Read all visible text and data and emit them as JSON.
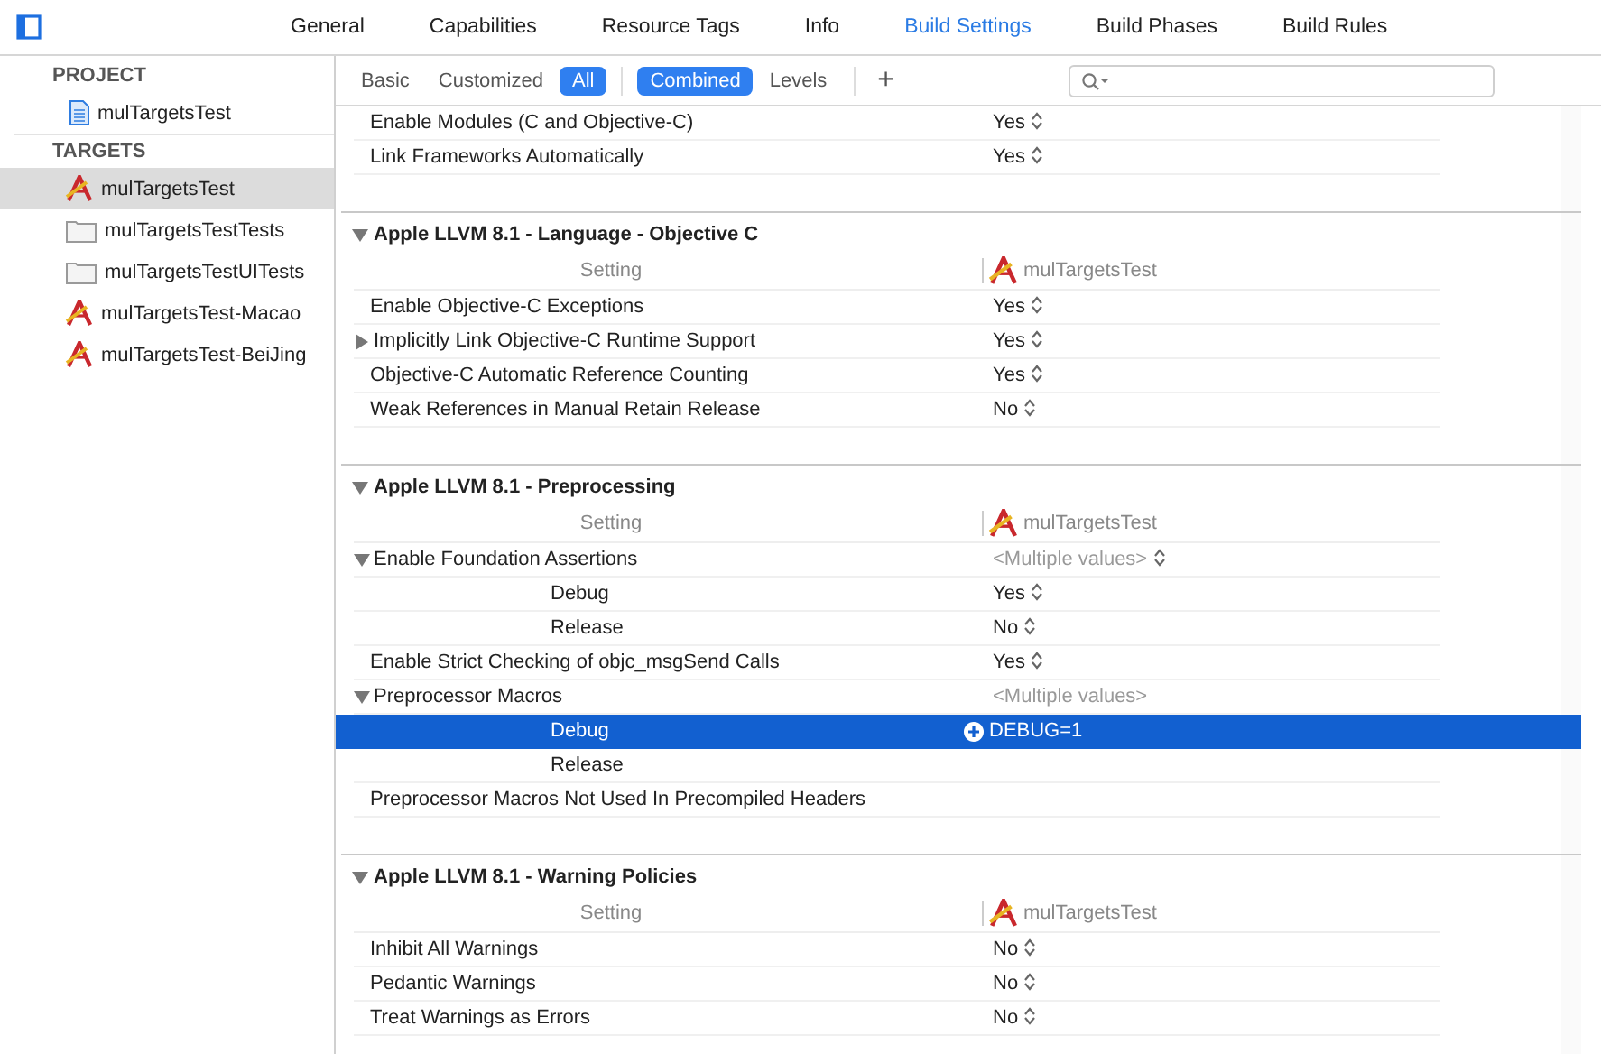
{
  "tabs": [
    {
      "label": "General",
      "selected": false
    },
    {
      "label": "Capabilities",
      "selected": false
    },
    {
      "label": "Resource Tags",
      "selected": false
    },
    {
      "label": "Info",
      "selected": false
    },
    {
      "label": "Build Settings",
      "selected": true
    },
    {
      "label": "Build Phases",
      "selected": false
    },
    {
      "label": "Build Rules",
      "selected": false
    }
  ],
  "sidebar": {
    "groups": [
      {
        "title": "PROJECT",
        "items": [
          {
            "label": "mulTargetsTest",
            "kind": "project",
            "selected": false
          }
        ]
      },
      {
        "title": "TARGETS",
        "items": [
          {
            "label": "mulTargetsTest",
            "kind": "app",
            "selected": true
          },
          {
            "label": "mulTargetsTestTests",
            "kind": "bundle",
            "selected": false
          },
          {
            "label": "mulTargetsTestUITests",
            "kind": "bundle",
            "selected": false
          },
          {
            "label": "mulTargetsTest-Macao",
            "kind": "app",
            "selected": false
          },
          {
            "label": "mulTargetsTest-BeiJing",
            "kind": "app",
            "selected": false
          }
        ]
      }
    ]
  },
  "filter_bar": {
    "scope": [
      {
        "label": "Basic",
        "selected": false
      },
      {
        "label": "Customized",
        "selected": false
      },
      {
        "label": "All",
        "selected": true
      }
    ],
    "view": [
      {
        "label": "Combined",
        "selected": true
      },
      {
        "label": "Levels",
        "selected": false
      }
    ],
    "add_label": "+"
  },
  "sections": [
    {
      "rows": [
        {
          "kind": "setting",
          "label": "Enable Modules (C and Objective-C)",
          "value": "Yes",
          "stepper": true,
          "selected": false
        },
        {
          "kind": "setting",
          "label": "Link Frameworks Automatically",
          "value": "Yes",
          "stepper": true,
          "selected": false
        }
      ]
    },
    {
      "title": "Apple LLVM 8.1 - Language - Objective C",
      "expanded": true,
      "column": "Setting",
      "target": "mulTargetsTest",
      "rows": [
        {
          "kind": "setting",
          "label": "Enable Objective-C Exceptions",
          "value": "Yes",
          "stepper": true,
          "selected": false
        },
        {
          "kind": "group",
          "expanded": false,
          "label": "Implicitly Link Objective-C Runtime Support",
          "value": "Yes",
          "stepper": true,
          "selected": false
        },
        {
          "kind": "setting",
          "label": "Objective-C Automatic Reference Counting",
          "value": "Yes",
          "stepper": true,
          "selected": false
        },
        {
          "kind": "setting",
          "label": "Weak References in Manual Retain Release",
          "value": "No",
          "stepper": true,
          "selected": false
        }
      ]
    },
    {
      "title": "Apple LLVM 8.1 - Preprocessing",
      "expanded": true,
      "column": "Setting",
      "target": "mulTargetsTest",
      "rows": [
        {
          "kind": "group",
          "expanded": true,
          "label": "Enable Foundation Assertions",
          "value": "<Multiple values>",
          "stepper": true,
          "selected": false
        },
        {
          "kind": "config",
          "label": "Debug",
          "value": "Yes",
          "stepper": true,
          "selected": false
        },
        {
          "kind": "config",
          "label": "Release",
          "value": "No",
          "stepper": true,
          "selected": false
        },
        {
          "kind": "setting",
          "label": "Enable Strict Checking of objc_msgSend Calls",
          "value": "Yes",
          "stepper": true,
          "selected": false
        },
        {
          "kind": "group",
          "expanded": true,
          "label": "Preprocessor Macros",
          "value": "<Multiple values>",
          "stepper": false,
          "selected": false
        },
        {
          "kind": "config",
          "label": "Debug",
          "value": "DEBUG=1",
          "stepper": false,
          "selected": true
        },
        {
          "kind": "config",
          "label": "Release",
          "selected": false
        },
        {
          "kind": "setting",
          "label": "Preprocessor Macros Not Used In Precompiled Headers",
          "selected": false
        }
      ]
    },
    {
      "title": "Apple LLVM 8.1 - Warning Policies",
      "expanded": true,
      "column": "Setting",
      "target": "mulTargetsTest",
      "rows": [
        {
          "kind": "setting",
          "label": "Inhibit All Warnings",
          "value": "No",
          "stepper": true,
          "selected": false
        },
        {
          "kind": "setting",
          "label": "Pedantic Warnings",
          "value": "No",
          "stepper": true,
          "selected": false
        },
        {
          "kind": "setting",
          "label": "Treat Warnings as Errors",
          "value": "No",
          "stepper": true,
          "selected": false
        }
      ]
    }
  ]
}
